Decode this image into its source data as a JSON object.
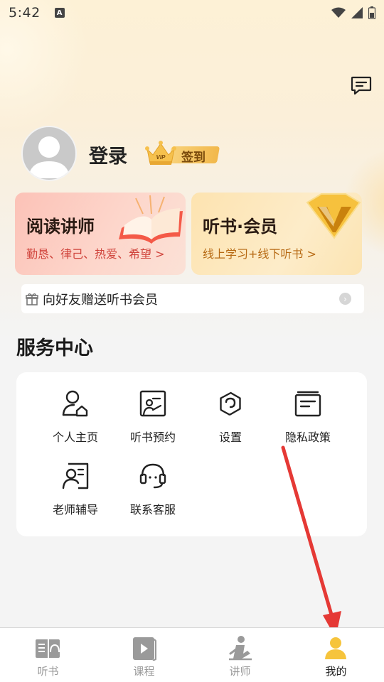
{
  "status_bar": {
    "time": "5:42",
    "notification_letter": "A"
  },
  "profile": {
    "login_label": "登录",
    "sign_in_label": "签到",
    "crown_text": "VIP"
  },
  "cards": {
    "reading_teacher": {
      "title": "阅读讲师",
      "subtitle": "勤恳、律己、热爱、希望 >"
    },
    "audiobook_vip": {
      "title": "听书·会员",
      "subtitle": "线上学习+线下听书 >"
    }
  },
  "gift_bar": {
    "text": "向好友赠送听书会员",
    "arrow": "›"
  },
  "service_center": {
    "title": "服务中心",
    "items": [
      {
        "label": "个人主页",
        "icon": "person-home-icon"
      },
      {
        "label": "听书预约",
        "icon": "board-person-icon"
      },
      {
        "label": "设置",
        "icon": "gear-icon"
      },
      {
        "label": "隐私政策",
        "icon": "document-icon"
      },
      {
        "label": "老师辅导",
        "icon": "tutor-icon"
      },
      {
        "label": "联系客服",
        "icon": "headset-icon"
      }
    ]
  },
  "bottom_nav": {
    "items": [
      {
        "label": "听书",
        "icon": "audiobook-icon",
        "active": false
      },
      {
        "label": "课程",
        "icon": "course-play-icon",
        "active": false
      },
      {
        "label": "讲师",
        "icon": "lecturer-icon",
        "active": false
      },
      {
        "label": "我的",
        "icon": "me-icon",
        "active": true
      }
    ]
  },
  "colors": {
    "accent_red": "#e53935",
    "active_yellow": "#f6c43c",
    "card_red_text": "#d0443c",
    "card_gold_text": "#b76a14"
  }
}
